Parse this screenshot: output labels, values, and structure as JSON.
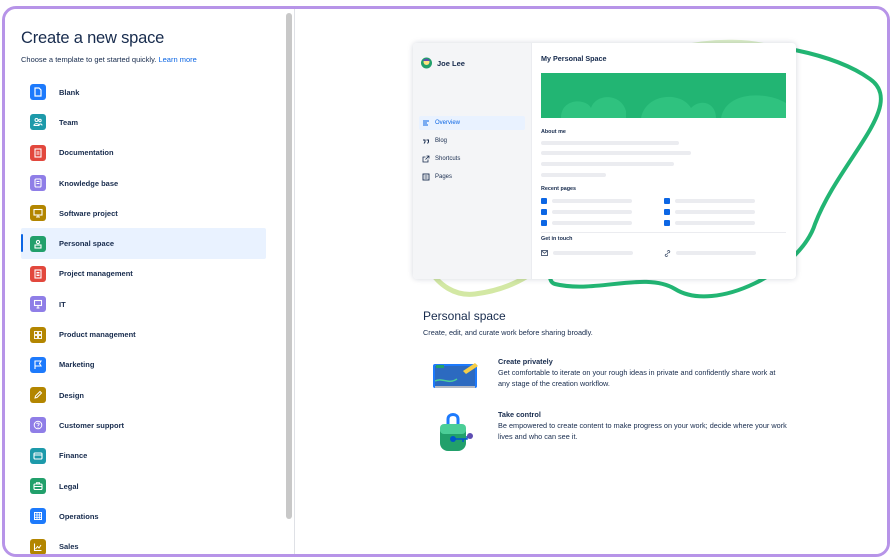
{
  "sidebar": {
    "title": "Create a new space",
    "subtitle": "Choose a template to get started quickly.",
    "learn_more": "Learn more",
    "items": [
      {
        "label": "Blank",
        "icon": "page-icon",
        "color": "#1d7afc"
      },
      {
        "label": "Team",
        "icon": "people-icon",
        "color": "#1d9aaa"
      },
      {
        "label": "Documentation",
        "icon": "document-icon",
        "color": "#e2483d"
      },
      {
        "label": "Knowledge base",
        "icon": "book-icon",
        "color": "#8f7ee7"
      },
      {
        "label": "Software project",
        "icon": "monitor-icon",
        "color": "#b38600"
      },
      {
        "label": "Personal space",
        "icon": "person-icon",
        "color": "#22a06b",
        "selected": true
      },
      {
        "label": "Project management",
        "icon": "clipboard-icon",
        "color": "#e2483d"
      },
      {
        "label": "IT",
        "icon": "laptop-icon",
        "color": "#8f7ee7"
      },
      {
        "label": "Product management",
        "icon": "grid-icon",
        "color": "#b38600"
      },
      {
        "label": "Marketing",
        "icon": "flag-icon",
        "color": "#1d7afc"
      },
      {
        "label": "Design",
        "icon": "pencil-icon",
        "color": "#b38600"
      },
      {
        "label": "Customer support",
        "icon": "question-icon",
        "color": "#8f7ee7"
      },
      {
        "label": "Finance",
        "icon": "card-icon",
        "color": "#1d9aaa"
      },
      {
        "label": "Legal",
        "icon": "briefcase-icon",
        "color": "#22a06b"
      },
      {
        "label": "Operations",
        "icon": "calculator-icon",
        "color": "#1d7afc"
      },
      {
        "label": "Sales",
        "icon": "chart-icon",
        "color": "#b38600"
      }
    ]
  },
  "preview": {
    "card": {
      "user_name": "Joe Lee",
      "nav": [
        {
          "label": "Overview",
          "icon": "overview-icon",
          "active": true
        },
        {
          "label": "Blog",
          "icon": "quote-icon"
        },
        {
          "label": "Shortcuts",
          "icon": "external-link-icon"
        },
        {
          "label": "Pages",
          "icon": "pages-icon"
        }
      ],
      "title": "My Personal Space",
      "about_me": "About me",
      "recent_pages": "Recent pages",
      "get_in_touch": "Get in touch"
    },
    "title": "Personal space",
    "description": "Create, edit, and curate work before sharing broadly.",
    "features": [
      {
        "title": "Create privately",
        "description": "Get comfortable to iterate on your rough ideas in private and confidently share work at any stage of the creation workflow."
      },
      {
        "title": "Take control",
        "description": "Be empowered to create content to make progress on your work; decide where your work lives and who can see it."
      }
    ]
  }
}
